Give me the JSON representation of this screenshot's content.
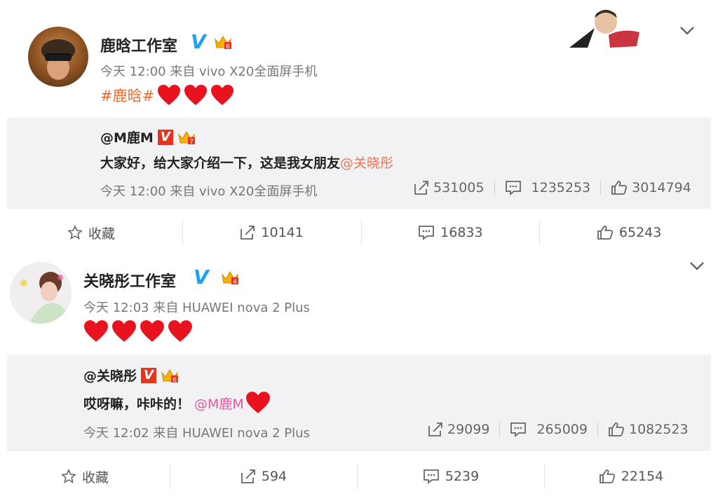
{
  "posts": [
    {
      "author": "鹿晗工作室",
      "level": "6",
      "meta": "今天 12:00 来自 vivo X20全面屏手机",
      "topic": "#鹿晗#",
      "repost": {
        "author": "@M鹿M",
        "level": "7",
        "text_prefix": "大家好，给大家介绍一下，这是我女朋友",
        "mention": "@关晓彤",
        "meta": "今天 12:00 来自 vivo X20全面屏手机",
        "shares": "531005",
        "comments": "1235253",
        "likes": "3014794"
      },
      "actions": {
        "favorite": "收藏",
        "shares": "10141",
        "comments": "16833",
        "likes": "65243"
      }
    },
    {
      "author": "关晓彤工作室",
      "level": "4",
      "meta": "今天 12:03 来自 HUAWEI nova 2 Plus",
      "repost": {
        "author": "@关晓彤",
        "level": "6",
        "text_prefix": "哎呀嘛，咔咔的！",
        "mention": "@M鹿M",
        "meta": "今天 12:02 来自 HUAWEI nova 2 Plus",
        "shares": "29099",
        "comments": "265009",
        "likes": "1082523"
      },
      "actions": {
        "favorite": "收藏",
        "shares": "594",
        "comments": "5239",
        "likes": "22154"
      }
    }
  ],
  "colors": {
    "topic": "#e86c2e",
    "mention": "#eb7350",
    "verified": "#1da1f2",
    "heart": "#e8131f"
  },
  "icons": [
    "heart-icon",
    "chevron-down-icon",
    "star-icon",
    "share-icon",
    "comment-icon",
    "like-icon",
    "crown-icon",
    "verified-icon"
  ]
}
